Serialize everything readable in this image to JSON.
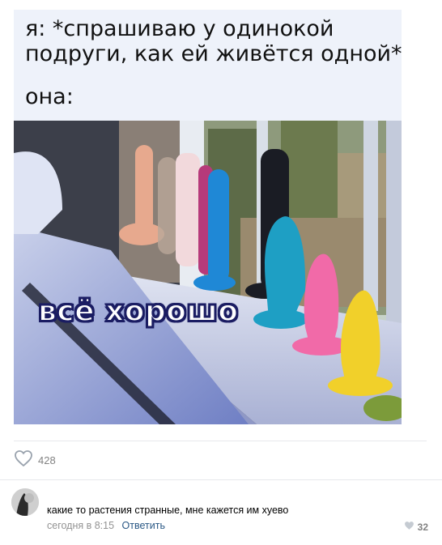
{
  "meme": {
    "caption_line1": "я: *спрашиваю у одинокой",
    "caption_line2": "подруги, как ей живётся одной*",
    "caption_line3": "она:",
    "overlay_text": "всё хорошо"
  },
  "post": {
    "likes_count": "428"
  },
  "comment": {
    "text": "какие то растения странные, мне кажется им хуево",
    "time": "сегодня в 8:15",
    "reply_label": "Ответить",
    "likes_count": "32"
  },
  "colors": {
    "caption_bg": "#eef2fa",
    "link": "#2a5885",
    "muted": "#828282"
  },
  "icons": [
    "heart-icon",
    "small-heart-icon"
  ]
}
